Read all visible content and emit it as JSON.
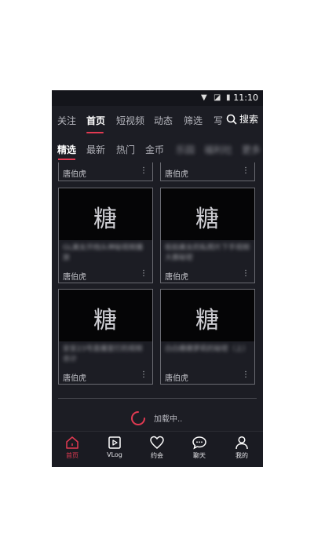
{
  "status_bar": {
    "time": "11:10"
  },
  "top_nav": {
    "tabs": [
      "关注",
      "首页",
      "短视频",
      "动态",
      "筛选",
      "写"
    ],
    "active_tab": "首页",
    "search_label": "搜索"
  },
  "sub_nav": {
    "tabs": [
      "精选",
      "最新",
      "热门",
      "金币"
    ],
    "blurred_tabs": [
      "乐园",
      "福利社",
      "更多"
    ],
    "active_tab": "精选"
  },
  "content": {
    "logo_char": "糖",
    "cards": [
      {
        "title": "",
        "author": "唐伯虎"
      },
      {
        "title": "",
        "author": "唐伯虎"
      },
      {
        "title": "GL美女开档头神秘视频播放",
        "author": "唐伯虎"
      },
      {
        "title": "街拍美女的私照片下手视频大赛秘密",
        "author": "唐伯虎"
      },
      {
        "title": "安安23号直播室打的视频合计",
        "author": "唐伯虎"
      },
      {
        "title": "白白嫩嫩萝莉的秘密（上）",
        "author": "唐伯虎"
      }
    ],
    "more_glyph": "⋮"
  },
  "loading": {
    "text": "加载中.."
  },
  "tab_bar": {
    "items": [
      {
        "label": "首页",
        "icon": "home-icon"
      },
      {
        "label": "VLog",
        "icon": "vlog-play-icon"
      },
      {
        "label": "约会",
        "icon": "heart-icon"
      },
      {
        "label": "聊天",
        "icon": "chat-icon"
      },
      {
        "label": "我的",
        "icon": "person-icon"
      }
    ],
    "active_index": 0
  },
  "colors": {
    "accent": "#e23a52",
    "background": "#1c1d24"
  }
}
